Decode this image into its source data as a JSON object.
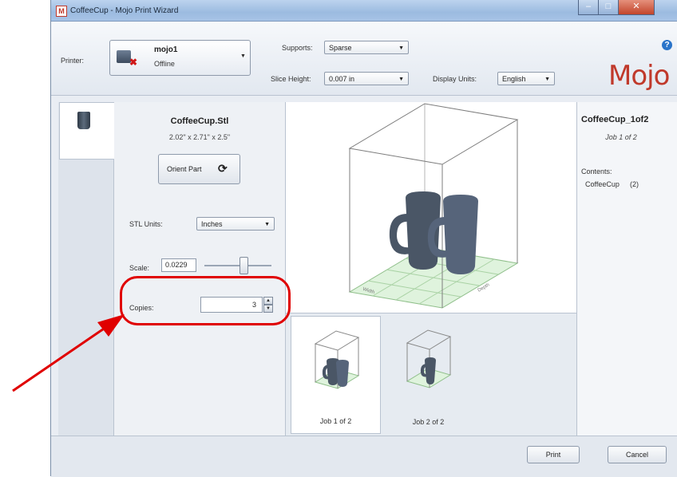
{
  "window": {
    "title": "CoffeeCup - Mojo Print Wizard",
    "app_icon_glyph": "M",
    "controls": {
      "minimize": "–",
      "maximize": "□",
      "close": "✕"
    }
  },
  "toolbar": {
    "printer_label": "Printer:",
    "printer_name": "mojo1",
    "printer_status": "Offline",
    "supports_label": "Supports:",
    "supports_value": "Sparse",
    "slice_height_label": "Slice Height:",
    "slice_height_value": "0.007 in",
    "display_units_label": "Display Units:",
    "display_units_value": "English",
    "help_glyph": "?",
    "logo": "Mojo"
  },
  "part": {
    "name": "CoffeeCup.Stl",
    "dimensions": "2.02\" x 2.71\" x 2.5\"",
    "orient_button": "Orient Part",
    "stl_units_label": "STL Units:",
    "stl_units_value": "Inches",
    "scale_label": "Scale:",
    "scale_value": "0.0229",
    "copies_label": "Copies:",
    "copies_value": "3"
  },
  "viewport": {
    "axis_x_label": "Width",
    "axis_y_label": "Depth"
  },
  "jobs": [
    {
      "label": "Job 1 of 2"
    },
    {
      "label": "Job 2 of 2"
    }
  ],
  "job_info": {
    "title": "CoffeeCup_1of2",
    "subtitle": "Job 1 of 2",
    "contents_label": "Contents:",
    "contents_item": "CoffeeCup",
    "contents_count": "(2)"
  },
  "buttons": {
    "print": "Print",
    "cancel": "Cancel"
  },
  "colors": {
    "accent": "#c0392b",
    "annotation": "#e00000",
    "mug": "#4a5666"
  }
}
